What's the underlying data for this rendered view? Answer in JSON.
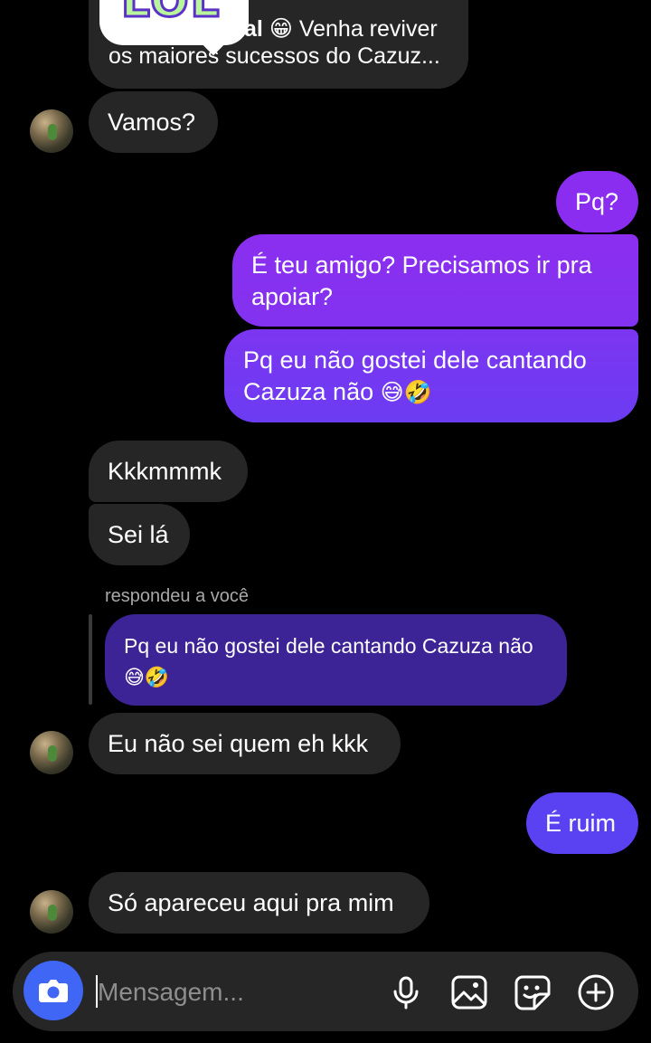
{
  "top_message": {
    "sticker_text": "LOL",
    "line1_visible": "al",
    "line1_emoji": "😁",
    "line1_rest": "Venha reviver",
    "line2": "os maiores sucessos do Cazuz..."
  },
  "messages": [
    {
      "side": "received",
      "text": "Vamos?"
    },
    {
      "side": "sent",
      "text": "Pq?"
    },
    {
      "side": "sent",
      "text_line1": "É teu amigo? Precisamos ir pra",
      "text_line2": "apoiar?"
    },
    {
      "side": "sent",
      "text_line1": "Pq eu não gostei dele cantando",
      "text_line2": "Cazuza não",
      "emojis": "😅🤣"
    },
    {
      "side": "received",
      "text": "Kkkmmmk"
    },
    {
      "side": "received",
      "text": "Sei lá"
    },
    {
      "side": "received",
      "text": "Eu não sei quem eh kkk"
    },
    {
      "side": "sent",
      "text": "É ruim"
    },
    {
      "side": "received",
      "text": "Só apareceu aqui pra mim"
    }
  ],
  "reply": {
    "label": "respondeu a você",
    "quoted_line1": "Pq eu não gostei dele cantando Cazuza não",
    "quoted_emojis": "😅🤣"
  },
  "composer": {
    "placeholder": "Mensagem...",
    "icons": [
      "camera-icon",
      "microphone-icon",
      "image-icon",
      "sticker-icon",
      "plus-icon"
    ]
  },
  "colors": {
    "background": "#000000",
    "received_bubble": "#262626",
    "sent_gradient_start": "#8a2df0",
    "sent_gradient_end": "#6b3cf2",
    "reply_quote_bubble": "#3c2396",
    "camera_button": "#3f66f5"
  }
}
